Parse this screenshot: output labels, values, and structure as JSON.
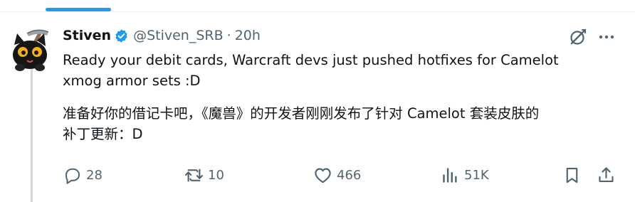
{
  "post": {
    "author_name": "Stiven",
    "author_handle": "@Stiven_SRB",
    "separator": "·",
    "time_ago": "20h",
    "text_en": "Ready your debit cards, Warcraft devs just pushed hotfixes for Camelot\nxmog armor sets :D",
    "text_zh": "准备好你的借记卡吧，《魔兽》的开发者刚刚发布了针对 Camelot 套装皮肤的\n补丁更新：D"
  },
  "actions": {
    "replies": "28",
    "reposts": "10",
    "likes": "466",
    "views": "51K"
  },
  "icons": {
    "verified": "verified-badge-icon",
    "grok": "grok-icon",
    "more": "more-options-icon",
    "reply": "reply-icon",
    "repost": "repost-icon",
    "like": "heart-icon",
    "views": "views-chart-icon",
    "bookmark": "bookmark-icon",
    "share": "share-icon"
  },
  "colors": {
    "accent": "#1d9bf0",
    "text": "#0f1419",
    "secondary": "#536471"
  }
}
